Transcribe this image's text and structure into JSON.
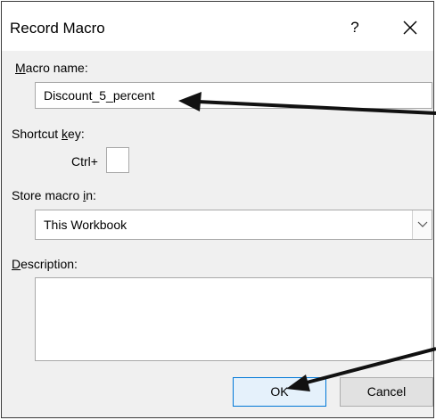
{
  "dialog": {
    "title": "Record Macro",
    "help_glyph": "?",
    "close_icon": "close-icon"
  },
  "macro_name": {
    "label_underlined": "M",
    "label_rest": "acro name:",
    "value": "Discount_5_percent"
  },
  "shortcut": {
    "label_before": "Shortcut ",
    "label_underlined": "k",
    "label_after": "ey:",
    "prefix": "Ctrl+",
    "value": ""
  },
  "store_in": {
    "label_before": "Store macro ",
    "label_underlined": "i",
    "label_after": "n:",
    "selected": "This Workbook",
    "dropdown_icon": "chevron-down-icon"
  },
  "description": {
    "label_underlined": "D",
    "label_rest": "escription:",
    "value": ""
  },
  "buttons": {
    "ok": "OK",
    "cancel": "Cancel"
  },
  "annotation_color": "#111111"
}
